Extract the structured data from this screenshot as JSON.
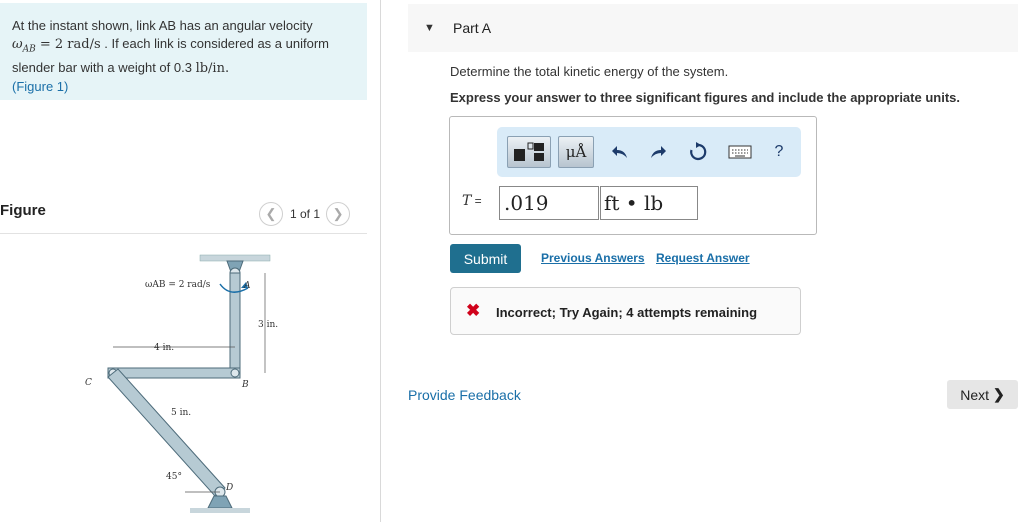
{
  "problem": {
    "line1": "At the instant shown, link AB has an angular velocity",
    "omega_sym": "ω",
    "omega_sub": "AB",
    "omega_eq": " = 2 rad/s",
    "line2_rest": " . If each link is considered as a uniform",
    "line3_pre": "slender bar with a weight of 0.3 ",
    "weight_unit": "lb/in.",
    "figure_link": "(Figure 1)"
  },
  "figure_panel": {
    "title": "Figure",
    "page_text": "1 of 1",
    "prev_icon": "chevron-left-icon",
    "next_icon": "chevron-right-icon"
  },
  "figure_labels": {
    "omega": "ωAB = 2 rad/s",
    "A": "A",
    "B": "B",
    "C": "C",
    "D": "D",
    "dim_3in": "3 in.",
    "dim_4in": "4 in.",
    "dim_5in": "5 in.",
    "angle": "45°"
  },
  "part": {
    "caret_icon": "triangle-down-icon",
    "title": "Part A",
    "question": "Determine the total kinetic energy of the system.",
    "instruction": "Express your answer to three significant figures and include the appropriate units."
  },
  "toolbar": {
    "templates_icon": "templates-icon",
    "units_label": "μÅ",
    "undo_icon": "undo-icon",
    "redo_icon": "redo-icon",
    "reset_icon": "reset-icon",
    "keyboard_icon": "keyboard-icon",
    "help_label": "?"
  },
  "answer": {
    "var": "T",
    "eq": " = ",
    "value": ".019",
    "units": "ft • lb"
  },
  "actions": {
    "submit": "Submit",
    "previous": "Previous Answers",
    "request": "Request Answer"
  },
  "feedback": {
    "icon": "x-icon",
    "mark": "✖",
    "text": "Incorrect; Try Again; 4 attempts remaining"
  },
  "footer": {
    "provide_feedback": "Provide Feedback",
    "next": "Next",
    "next_icon": "chevron-right-icon"
  },
  "colors": {
    "accent": "#1a6fa8",
    "submit_bg": "#1f6f8f",
    "problem_bg": "#e6f4f7",
    "error": "#d0021b"
  }
}
